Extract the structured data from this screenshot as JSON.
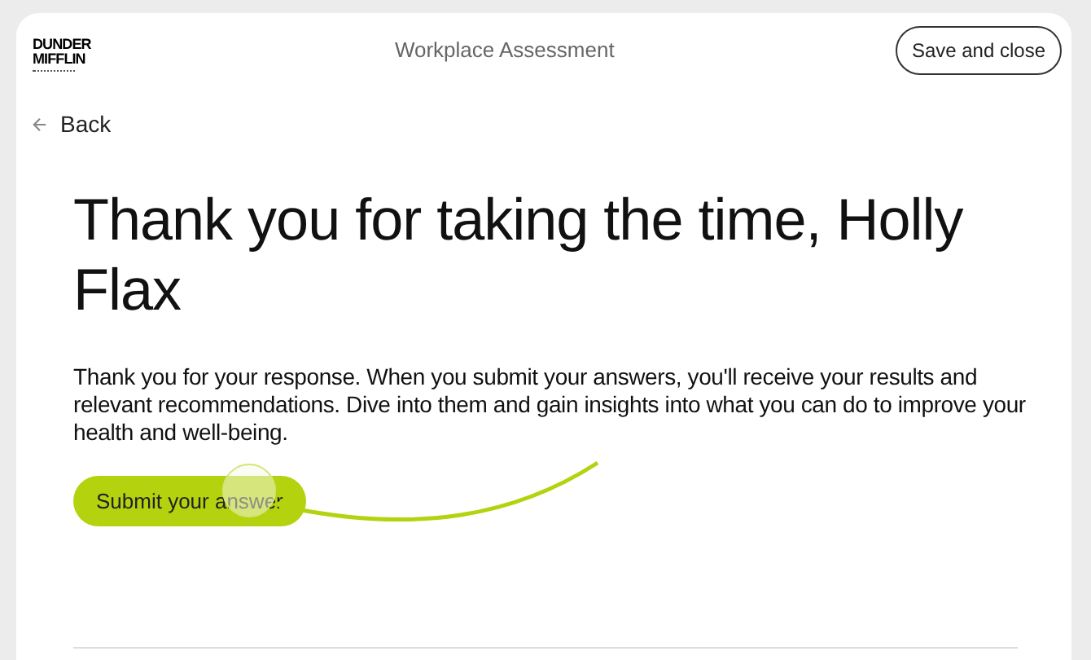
{
  "header": {
    "logo": {
      "line_1": "DUNDER",
      "line_2": "MIFFLIN"
    },
    "title": "Workplace Assessment",
    "save_button": "Save and close"
  },
  "back_link": "Back",
  "heading": "Thank you for taking the time, Holly Flax",
  "body": "Thank you for your response. When you submit your answers, you'll receive your results and relevant recommendations. Dive into them and gain insights into what you can do to improve your health and well-being.",
  "submit_button": "Submit your answer"
}
